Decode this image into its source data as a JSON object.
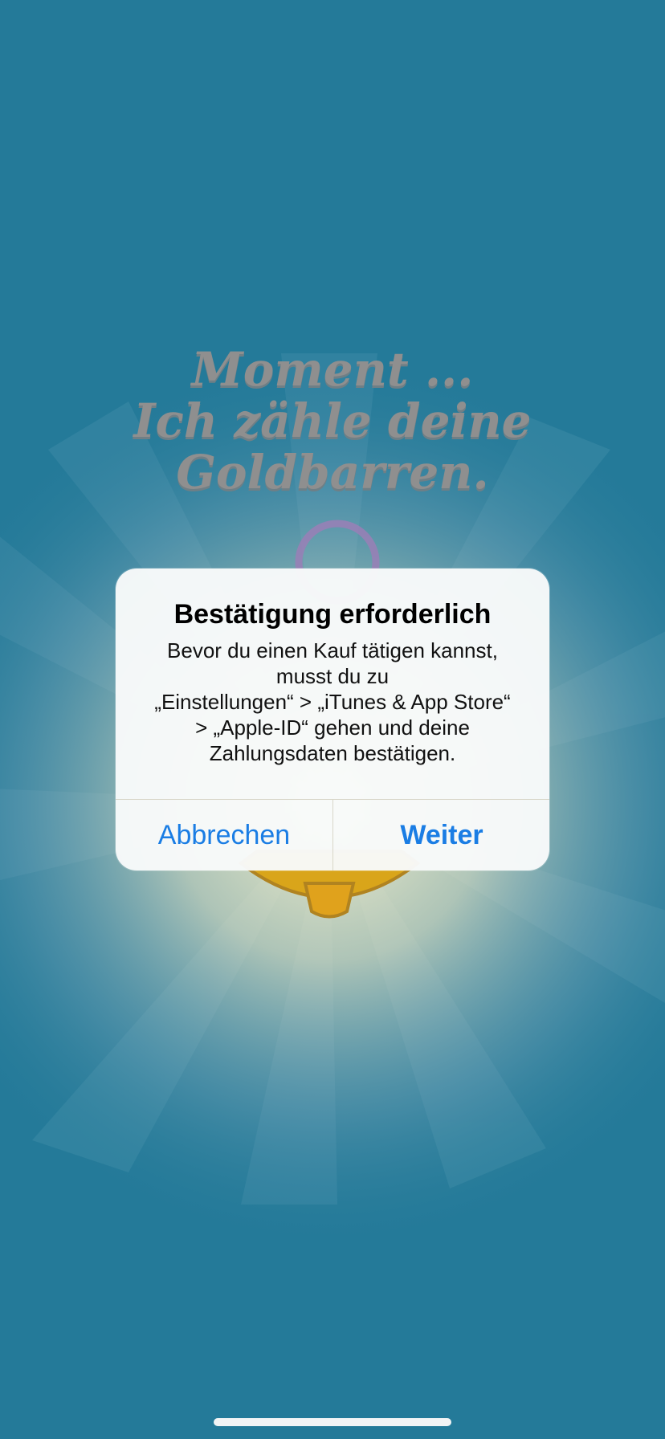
{
  "background": {
    "color": "#247a99",
    "loading_lines": [
      "Moment  ...",
      "Ich zähle deine",
      "Goldbarren."
    ]
  },
  "alert": {
    "title": "Bestätigung erforderlich",
    "message_lines": [
      "Bevor du einen Kauf tätigen kannst,",
      "musst du zu",
      "„Einstellungen“ > „iTunes & App Store“",
      "> „Apple-ID“ gehen und deine",
      "Zahlungsdaten bestätigen."
    ],
    "cancel_label": "Abbrechen",
    "continue_label": "Weiter",
    "accent_color": "#1a7de4"
  }
}
